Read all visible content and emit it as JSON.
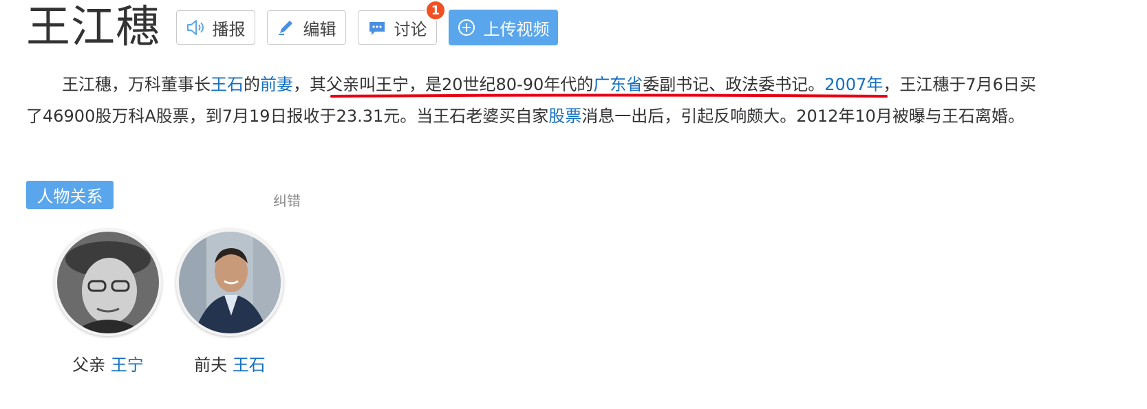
{
  "title": "王江穗",
  "toolbar": {
    "broadcast_label": "播报",
    "edit_label": "编辑",
    "discuss_label": "讨论",
    "discuss_badge": "1",
    "upload_label": "上传视频"
  },
  "summary": {
    "s1": "王江穗，万科董事长",
    "l1": "王石",
    "s2": "的",
    "l2": "前妻",
    "s3": "，",
    "s4": "其父亲叫王宁，是20世纪80-90年代的",
    "l3": "广东省",
    "s5": "委副书记、政法委书记。",
    "l4": "2007年",
    "s6": "，王江穗于7月6日买了46900股万科A股票，到7月19日报收于23.31元。当王石老婆买自家",
    "l5": "股票",
    "s7": "消息一出后，引起反响颇大。2012年10月被曝与王石离婚。"
  },
  "relations": {
    "tag": "人物关系",
    "correct_label": "纠错",
    "people": [
      {
        "relation": "父亲",
        "name": "王宁"
      },
      {
        "relation": "前夫",
        "name": "王石"
      }
    ]
  },
  "colors": {
    "accent": "#5aa6ec",
    "link": "#136ec2",
    "badge": "#f25022",
    "underline_mark": "#e60012"
  }
}
